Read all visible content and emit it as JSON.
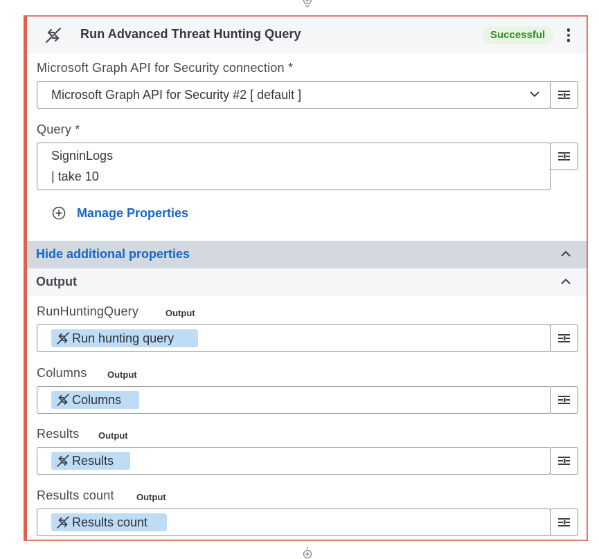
{
  "card": {
    "title": "Run Advanced Threat Hunting Query",
    "status": "Successful",
    "title_icon": "integration-link-icon",
    "menu_icon": "kebab-menu-icon"
  },
  "colors": {
    "accent_border": "#e0604c",
    "status_bg": "#e9f5e4",
    "status_text": "#2f8a1f",
    "link": "#1766c8",
    "chip_bg": "#bfdcf7"
  },
  "connection": {
    "label": "Microsoft Graph API for Security connection *",
    "value": "Microsoft Graph API for Security #2 [ default ]"
  },
  "query": {
    "label": "Query *",
    "lines": [
      "SigninLogs",
      "| take 10"
    ]
  },
  "manage_properties": "Manage Properties",
  "hide_additional": "Hide additional properties",
  "output_section": "Output",
  "outputs": [
    {
      "label": "RunHuntingQuery",
      "tag": "Output",
      "chip": "Run hunting query"
    },
    {
      "label": "Columns",
      "tag": "Output",
      "chip": "Columns"
    },
    {
      "label": "Results",
      "tag": "Output",
      "chip": "Results"
    },
    {
      "label": "Results count",
      "tag": "Output",
      "chip": "Results count"
    }
  ]
}
